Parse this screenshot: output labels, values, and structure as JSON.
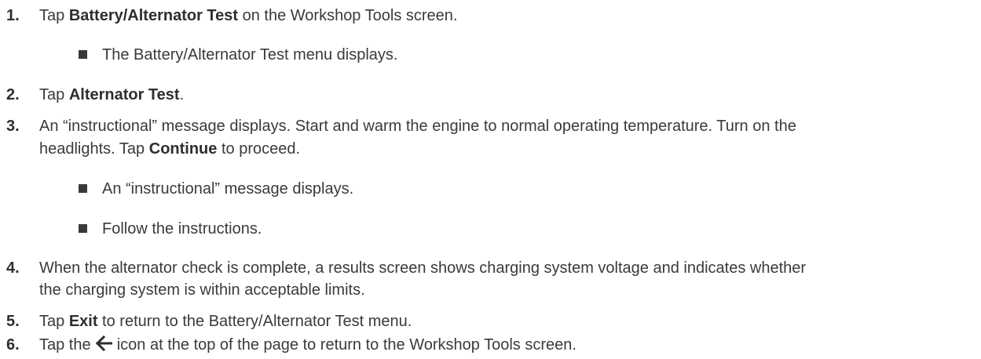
{
  "steps": [
    {
      "num": "1.",
      "pre": "Tap ",
      "bold": "Battery/Alternator Test",
      "post": " on the Workshop Tools screen."
    },
    {
      "bullets": [
        "The Battery/Alternator Test menu displays."
      ]
    },
    {
      "num": "2.",
      "pre": "Tap ",
      "bold": "Alternator Test",
      "post": "."
    },
    {
      "num": "3.",
      "line1": "An “instructional” message displays. Start and warm the engine to normal operating temperature. Turn on the",
      "line2_pre": "headlights. Tap ",
      "bold": "Continue",
      "post": " to proceed."
    },
    {
      "bullets": [
        "An “instructional” message displays.",
        "Follow the instructions."
      ]
    },
    {
      "num": "4.",
      "line1": "When the alternator check is complete, a results screen shows charging system voltage and indicates whether",
      "line2": "the charging system is within acceptable limits."
    },
    {
      "num": "5.",
      "pre": "Tap ",
      "bold": "Exit",
      "post": " to return to the Battery/Alternator Test menu."
    },
    {
      "num": "6.",
      "pre": "Tap the ",
      "icon": "left-arrow-icon",
      "post": " icon at the top of the page to return to the Workshop Tools screen."
    }
  ]
}
